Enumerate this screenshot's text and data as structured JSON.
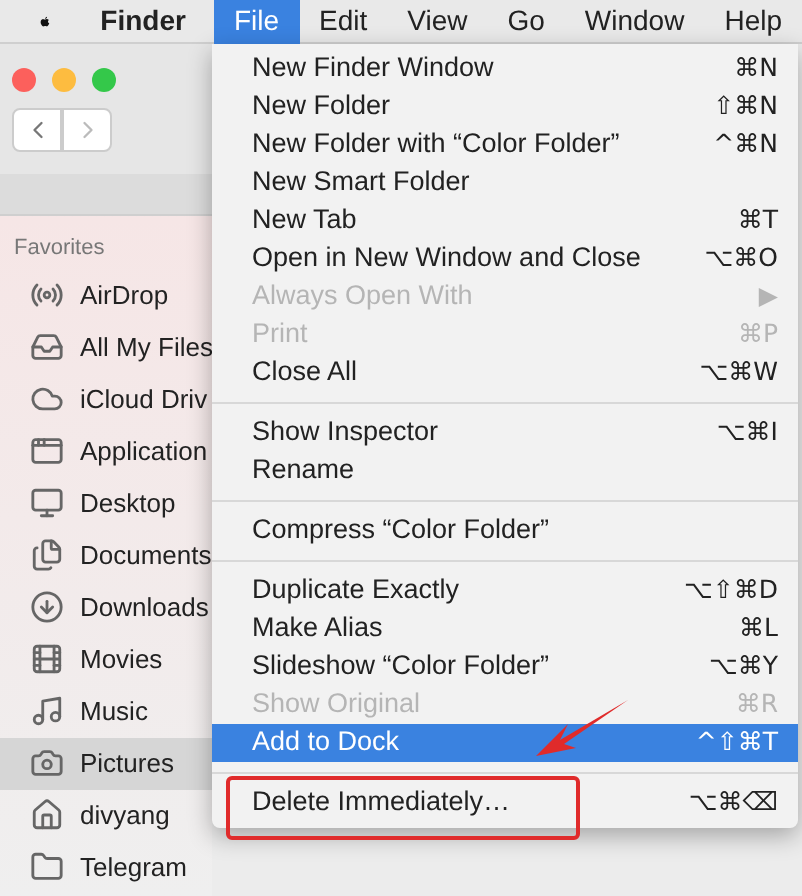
{
  "menu_bar": {
    "app": "Finder",
    "menus": [
      {
        "label": "File",
        "selected": true
      },
      {
        "label": "Edit",
        "selected": false
      },
      {
        "label": "View",
        "selected": false
      },
      {
        "label": "Go",
        "selected": false
      },
      {
        "label": "Window",
        "selected": false
      },
      {
        "label": "Help",
        "selected": false
      }
    ]
  },
  "sidebar": {
    "heading": "Favorites",
    "items": [
      {
        "label": "AirDrop",
        "selected": false
      },
      {
        "label": "All My Files",
        "selected": false
      },
      {
        "label": "iCloud Driv",
        "selected": false
      },
      {
        "label": "Application",
        "selected": false
      },
      {
        "label": "Desktop",
        "selected": false
      },
      {
        "label": "Documents",
        "selected": false
      },
      {
        "label": "Downloads",
        "selected": false
      },
      {
        "label": "Movies",
        "selected": false
      },
      {
        "label": "Music",
        "selected": false
      },
      {
        "label": "Pictures",
        "selected": true
      },
      {
        "label": "divyang",
        "selected": false
      },
      {
        "label": "Telegram",
        "selected": false
      }
    ]
  },
  "file_menu": [
    {
      "kind": "item",
      "label": "New Finder Window",
      "shortcut": "⌘N",
      "disabled": false,
      "selected": false
    },
    {
      "kind": "item",
      "label": "New Folder",
      "shortcut": "⇧⌘N",
      "disabled": false,
      "selected": false
    },
    {
      "kind": "item",
      "label": "New Folder with “Color Folder”",
      "shortcut": "^⌘N",
      "disabled": false,
      "selected": false
    },
    {
      "kind": "item",
      "label": "New Smart Folder",
      "disabled": false,
      "selected": false
    },
    {
      "kind": "item",
      "label": "New Tab",
      "shortcut": "⌘T",
      "disabled": false,
      "selected": false
    },
    {
      "kind": "item",
      "label": "Open in New Window and Close",
      "shortcut": "⌥⌘O",
      "disabled": false,
      "selected": false
    },
    {
      "kind": "item",
      "label": "Always Open With",
      "shortcut": "▶",
      "disabled": true,
      "selected": false
    },
    {
      "kind": "item",
      "label": "Print",
      "shortcut": "⌘P",
      "disabled": true,
      "selected": false
    },
    {
      "kind": "item",
      "label": "Close All",
      "shortcut": "⌥⌘W",
      "disabled": false,
      "selected": false
    },
    {
      "kind": "separator"
    },
    {
      "kind": "item",
      "label": "Show Inspector",
      "shortcut": "⌥⌘I",
      "disabled": false,
      "selected": false
    },
    {
      "kind": "item",
      "label": "Rename",
      "disabled": false,
      "selected": false
    },
    {
      "kind": "separator"
    },
    {
      "kind": "item",
      "label": "Compress “Color Folder”",
      "disabled": false,
      "selected": false
    },
    {
      "kind": "separator"
    },
    {
      "kind": "item",
      "label": "Duplicate Exactly",
      "shortcut": "⌥⇧⌘D",
      "disabled": false,
      "selected": false
    },
    {
      "kind": "item",
      "label": "Make Alias",
      "shortcut": "⌘L",
      "disabled": false,
      "selected": false
    },
    {
      "kind": "item",
      "label": "Slideshow “Color Folder”",
      "shortcut": "⌥⌘Y",
      "disabled": false,
      "selected": false
    },
    {
      "kind": "item",
      "label": "Show Original",
      "shortcut": "⌘R",
      "disabled": true,
      "selected": false
    },
    {
      "kind": "item",
      "label": "Add to Dock",
      "shortcut": "^⇧⌘T",
      "disabled": false,
      "selected": true
    },
    {
      "kind": "separator"
    },
    {
      "kind": "item",
      "label": "Delete Immediately…",
      "shortcut": "⌥⌘⌫",
      "disabled": false,
      "selected": false
    }
  ]
}
